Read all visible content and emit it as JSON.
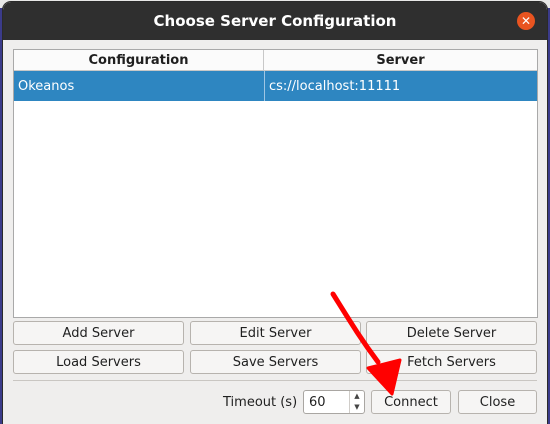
{
  "window": {
    "title": "Choose Server Configuration",
    "close_glyph": "✕"
  },
  "table": {
    "headers": [
      "Configuration",
      "Server"
    ],
    "rows": [
      {
        "configuration": "Okeanos",
        "server": "cs://localhost:11111",
        "selected": true
      }
    ]
  },
  "buttons": {
    "add_server": "Add Server",
    "edit_server": "Edit Server",
    "delete_server": "Delete Server",
    "load_servers": "Load Servers",
    "save_servers": "Save Servers",
    "fetch_servers": "Fetch Servers",
    "connect": "Connect",
    "close": "Close"
  },
  "timeout": {
    "label": "Timeout (s)",
    "value": "60"
  },
  "colors": {
    "titlebar": "#2f2f2f",
    "selection": "#2e86c1",
    "close_button": "#e95420",
    "annotation_arrow": "#ff0000"
  },
  "icons": {
    "close": "close-icon",
    "spin_up": "arrow-up-icon",
    "spin_down": "arrow-down-icon"
  }
}
